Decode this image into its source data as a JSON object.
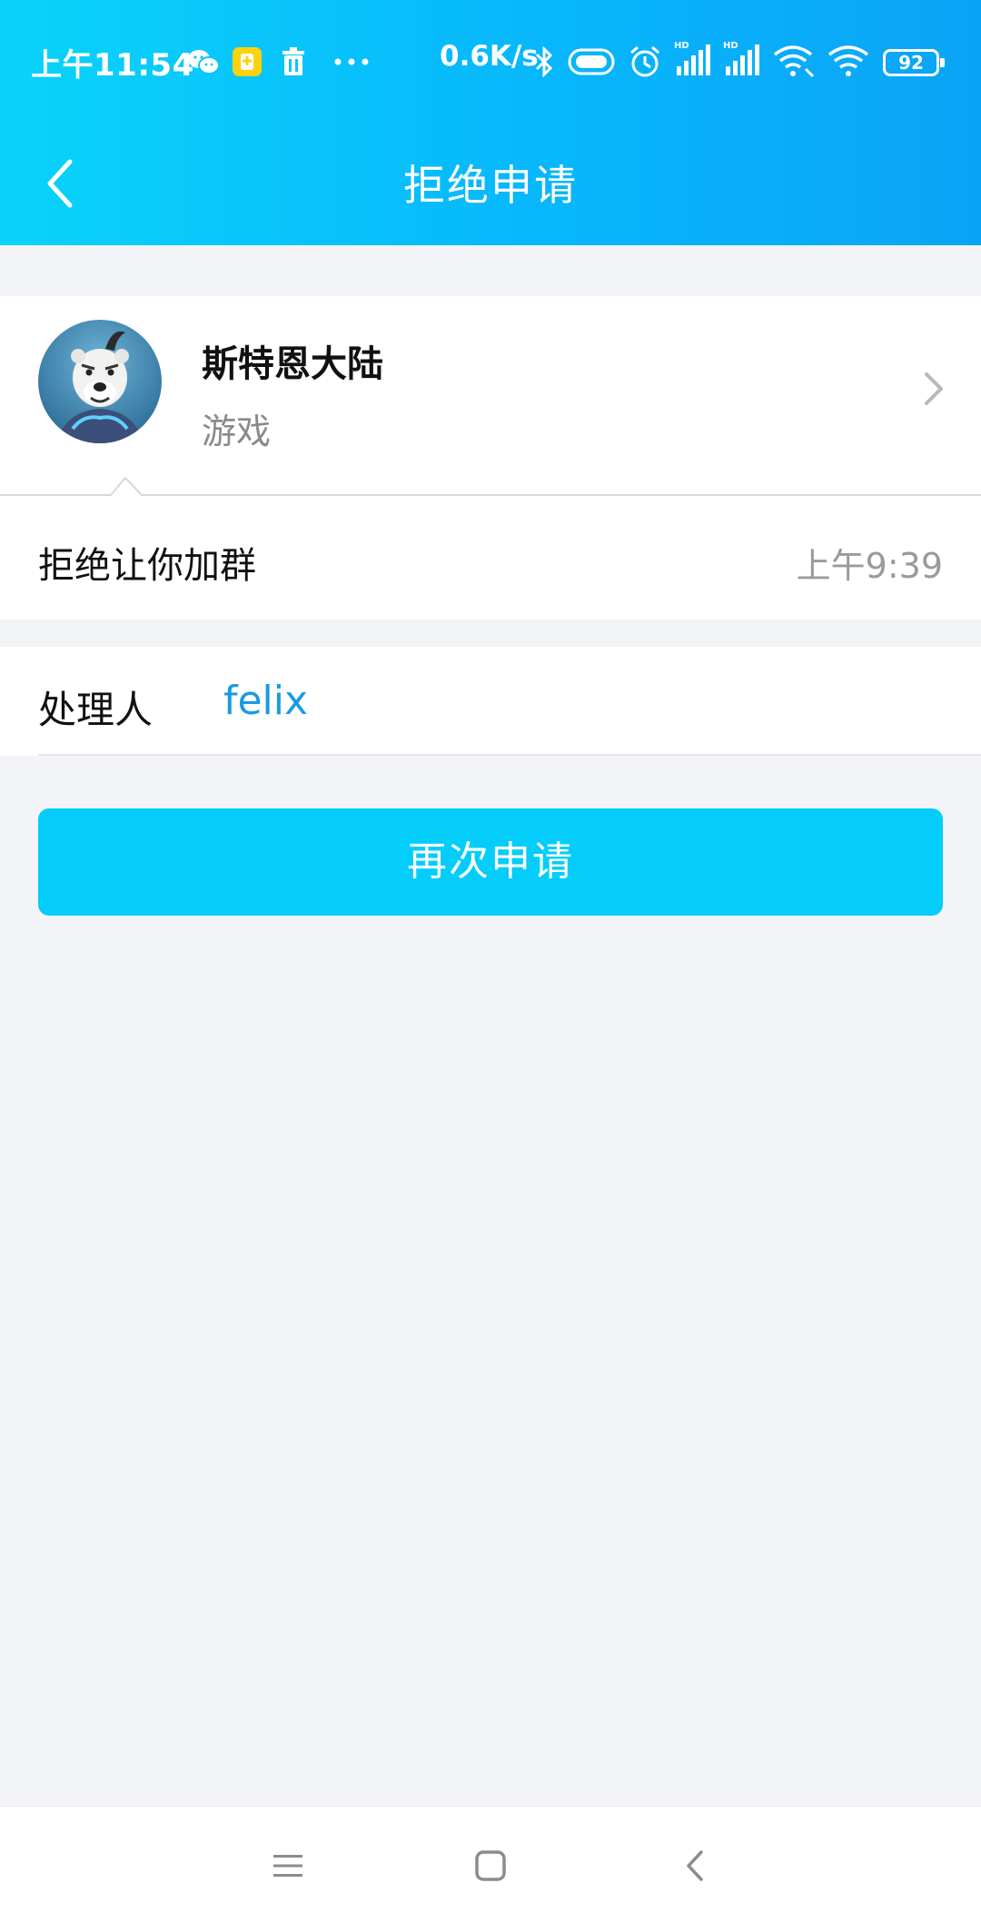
{
  "status_bar": {
    "time": "上午11:54",
    "network_speed": "0.6K/s",
    "battery": "92",
    "icons": [
      "wechat-icon",
      "app-badge-icon",
      "trash-icon",
      "more-dots-icon",
      "bluetooth-icon",
      "vibrate-icon",
      "alarm-icon",
      "signal-hd-1-icon",
      "signal-hd-2-icon",
      "wifi-assist-icon",
      "wifi-icon",
      "battery-icon"
    ]
  },
  "nav": {
    "title": "拒绝申请",
    "back_icon": "chevron-left-icon"
  },
  "profile": {
    "name": "斯特恩大陆",
    "category": "游戏",
    "chevron_icon": "chevron-right-icon"
  },
  "message": {
    "text": "拒绝让你加群",
    "time": "上午9:39"
  },
  "handler": {
    "label": "处理人",
    "value": "felix"
  },
  "action": {
    "label": "再次申请"
  },
  "bottom_nav": {
    "icons": [
      "menu-icon",
      "home-square-icon",
      "back-chevron-icon"
    ]
  },
  "colors": {
    "header_start": "#09d3fb",
    "header_end": "#0aa4f6",
    "button": "#05cdfa",
    "link": "#1a9be0",
    "background": "#f2f4f8"
  }
}
